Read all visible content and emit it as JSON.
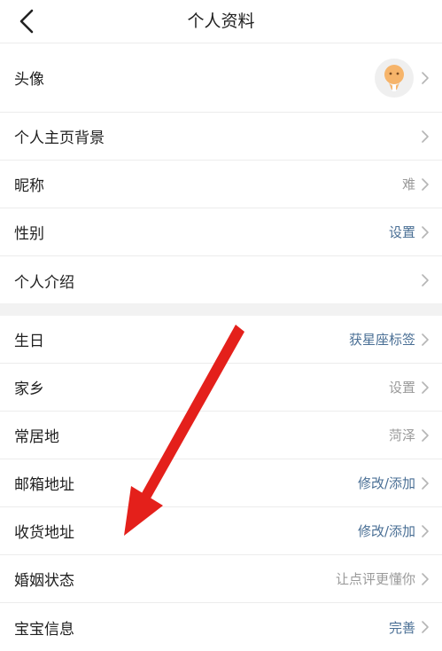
{
  "header": {
    "title": "个人资料"
  },
  "section1": [
    {
      "label": "头像",
      "value": "",
      "value_style": "avatar"
    },
    {
      "label": "个人主页背景",
      "value": "",
      "value_style": "muted"
    },
    {
      "label": "昵称",
      "value": "难",
      "value_style": "muted"
    },
    {
      "label": "性别",
      "value": "设置",
      "value_style": "blue"
    },
    {
      "label": "个人介绍",
      "value": "",
      "value_style": "muted"
    }
  ],
  "section2": [
    {
      "label": "生日",
      "value": "获星座标签",
      "value_style": "blue"
    },
    {
      "label": "家乡",
      "value": "设置",
      "value_style": "muted"
    },
    {
      "label": "常居地",
      "value": "菏泽",
      "value_style": "muted"
    },
    {
      "label": "邮箱地址",
      "value": "修改/添加",
      "value_style": "blue"
    },
    {
      "label": "收货地址",
      "value": "修改/添加",
      "value_style": "blue"
    },
    {
      "label": "婚姻状态",
      "value": "让点评更懂你",
      "value_style": "muted"
    },
    {
      "label": "宝宝信息",
      "value": "完善",
      "value_style": "blue"
    }
  ],
  "colors": {
    "accent_blue": "#4a6f95",
    "muted_gray": "#9a9a9a",
    "annotation_arrow": "#e4201b",
    "avatar_orange": "#f6b46a"
  },
  "icons": {
    "back": "chevron-left-icon",
    "row_arrow": "chevron-right-icon",
    "avatar": "avatar-icon"
  }
}
